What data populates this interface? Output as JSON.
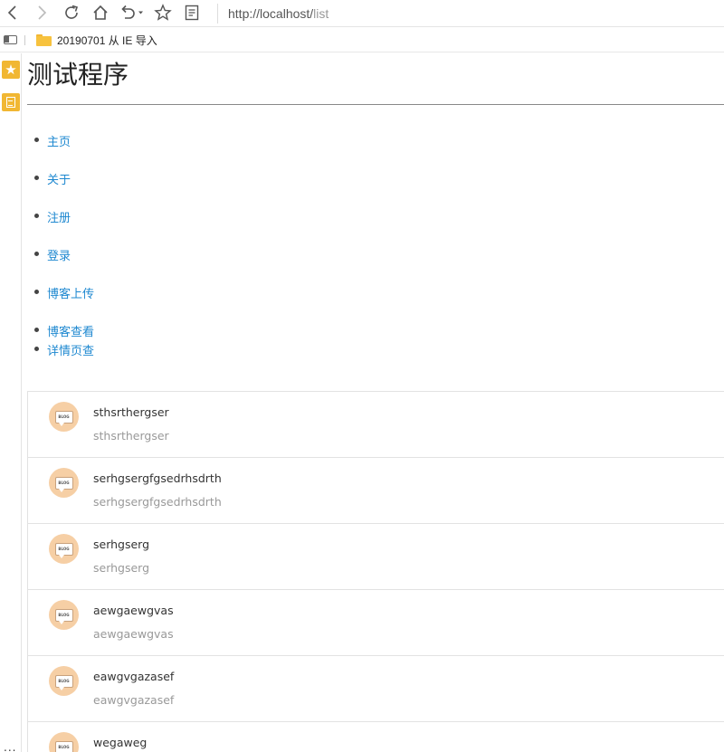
{
  "browser": {
    "url_host": "http://localhost/",
    "url_path": "list",
    "favorites": {
      "folder_label": "20190701 从 IE 导入"
    },
    "hub": {
      "more_label": "..."
    }
  },
  "page": {
    "title": "测试程序",
    "nav": [
      {
        "label": "主页"
      },
      {
        "label": "关于"
      },
      {
        "label": "注册"
      },
      {
        "label": "登录"
      },
      {
        "label": "博客上传"
      },
      {
        "label": "博客查看"
      },
      {
        "label": "详情页查"
      }
    ],
    "avatar_text": "BLOG",
    "blogs": [
      {
        "title": "sthsrthergser",
        "subtitle": "sthsrthergser"
      },
      {
        "title": "serhgsergfgsedrhsdrth",
        "subtitle": "serhgsergfgsedrhsdrth"
      },
      {
        "title": "serhgserg",
        "subtitle": "serhgserg"
      },
      {
        "title": "aewgaewgvas",
        "subtitle": "aewgaewgvas"
      },
      {
        "title": "eawgvgazasef",
        "subtitle": "eawgvgazasef"
      },
      {
        "title": "wegaweg",
        "subtitle": ""
      }
    ]
  },
  "colors": {
    "link": "#1e88d0",
    "hub_accent": "#f1b733",
    "avatar_bg": "#f6cfa5"
  }
}
